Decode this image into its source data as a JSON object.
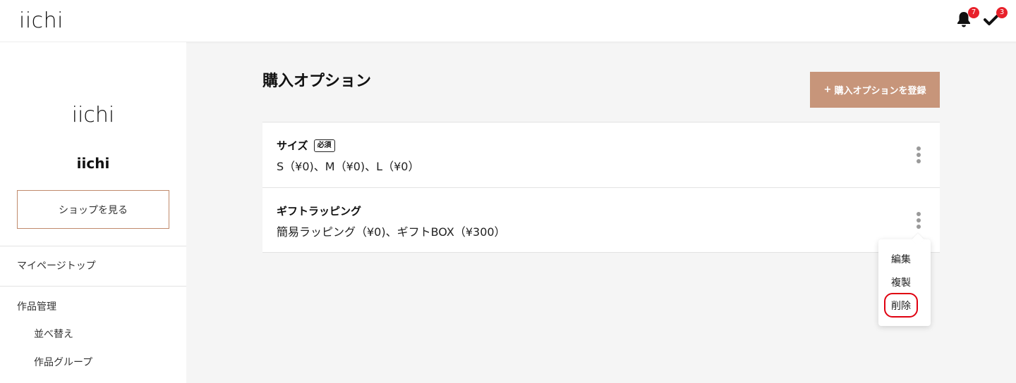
{
  "header": {
    "logo": "iichi",
    "notifications_count": "7",
    "tasks_count": "3"
  },
  "sidebar": {
    "shop_logo": "iichi",
    "shop_name": "iichi",
    "view_shop_label": "ショップを見る",
    "items": [
      {
        "label": "マイページトップ"
      },
      {
        "label": "作品管理"
      },
      {
        "label": "並べ替え"
      },
      {
        "label": "作品グループ"
      }
    ]
  },
  "main": {
    "title": "購入オプション",
    "register_label": "購入オプションを登録",
    "register_plus": "+",
    "options": [
      {
        "name": "サイズ",
        "required_label": "必須",
        "values": "S（¥0)、M（¥0)、L（¥0）"
      },
      {
        "name": "ギフトラッピング",
        "values": "簡易ラッピング（¥0)、ギフトBOX（¥300）"
      }
    ],
    "menu": {
      "items": [
        {
          "label": "編集"
        },
        {
          "label": "複製"
        },
        {
          "label": "削除"
        }
      ]
    }
  },
  "colors": {
    "accent": "#c7957a",
    "badge": "#e8202a",
    "highlight": "#e00010"
  }
}
